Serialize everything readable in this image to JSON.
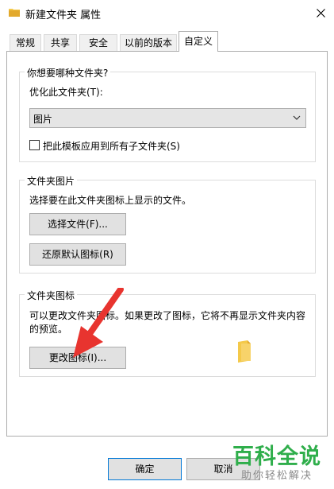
{
  "window": {
    "title": "新建文件夹 属性",
    "close_label": "✕"
  },
  "tabs": [
    {
      "label": "常规",
      "active": false
    },
    {
      "label": "共享",
      "active": false
    },
    {
      "label": "安全",
      "active": false
    },
    {
      "label": "以前的版本",
      "active": false
    },
    {
      "label": "自定义",
      "active": true
    }
  ],
  "folder_type": {
    "group_label": "你想要哪种文件夹?",
    "optimize_label": "优化此文件夹(T):",
    "selected_value": "图片",
    "apply_subfolders_label": "把此模板应用到所有子文件夹(S)",
    "apply_subfolders_checked": false
  },
  "folder_picture": {
    "group_label": "文件夹图片",
    "description": "选择要在此文件夹图标上显示的文件。",
    "choose_file_button": "选择文件(F)...",
    "restore_default_button": "还原默认图标(R)"
  },
  "folder_icon": {
    "group_label": "文件夹图标",
    "description_line1": "可以更改文件夹图标。如果更改了图标，它将不再显示文件夹内容",
    "description_line2": "的预览。",
    "change_icon_button": "更改图标(I)..."
  },
  "footer": {
    "ok_button": "确定",
    "cancel_button": "取消"
  },
  "watermark": {
    "title": "百科全说",
    "subtitle": "助你轻松解决"
  },
  "colors": {
    "folder_yellow": "#f4c94a",
    "folder_yellow_dark": "#e2a92d",
    "arrow_red": "#e8342f",
    "watermark_green": "#2fae4b"
  },
  "icons": {
    "folder": "folder-icon",
    "chevron": "chevron-down-icon",
    "close": "close-icon",
    "annotation": "red-arrow-icon"
  }
}
